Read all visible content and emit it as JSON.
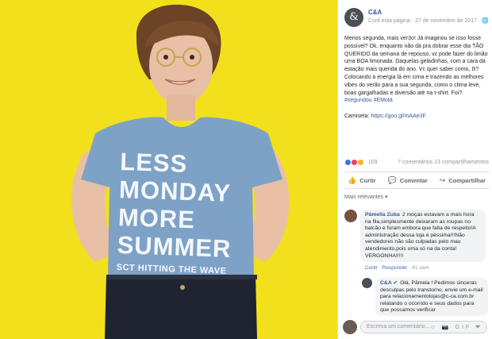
{
  "colors": {
    "photo_background": "#f2e01c",
    "link": "#385898",
    "shirt": "#7ea2c6"
  },
  "photo": {
    "shirt_lines": [
      "LESS",
      "MONDAY",
      "MORE",
      "SUMMER"
    ],
    "shirt_small_line": "SCT HITTING THE WAVE"
  },
  "post": {
    "page_name": "C&A",
    "avatar_glyph": "&",
    "meta": "Curti esta página · 27 de novembro de 2017 · 🌐",
    "body_main": "Menos segunda, mais ver3o! Já imaginou se isso fosse possível? Ok, enquanto não dá pra dobrar esse dia TÃO QUERIDO da semana de repouso, vc pode fazer do limão uma BOA limonada. Daquelas geladinhas, com a cara da estação mais querida do ano. Vc quer saber como, ẞ? Colocando a energia lá em cima e trazendo as melhores vibes do verão para a sua segunda, como o clima leve, boas gargalhadas e diversão até na t-shirt. Foi?",
    "hashtag": "#segundou #EMotá",
    "shirt_label": "Camiseta:",
    "shirt_link": "https://goo.gl/mAAe3F"
  },
  "reactions": {
    "icons": [
      "like",
      "love",
      "haha"
    ],
    "count": "169",
    "summary": "7 comentários  13 compartilhamentos"
  },
  "actions": [
    {
      "icon": "thumbs-up-icon",
      "glyph": "👍",
      "label": "Curtir"
    },
    {
      "icon": "comment-icon",
      "glyph": "💬",
      "label": "Comentar"
    },
    {
      "icon": "share-icon",
      "glyph": "↪",
      "label": "Compartilhar"
    }
  ],
  "relevance_label": "Mais relevantes ▾",
  "comments": [
    {
      "author": "Pâmella Zuba",
      "text": "2 moças estavam a mais hora na fila,simplesmente deixaram as roupas no balcão e foram embora que falta de respeito!A administração dessa loja é péssima!!!Não vendedores não são culpadas pelo mau atendimento,pois uma só na da conta! VERGONHA!!!!!",
      "footer_like": "Curtir",
      "footer_reply": "Responder",
      "footer_time": "· 41 sem"
    },
    {
      "author": "C&A ✔",
      "text": "Olá, Pâmela ! Pedimos sinceras desculpas pelo transtorno, envie um e-mail para relacionamentolojas@c-ca.com.br relatando o ocorrido e seus dados para que possamos verificar"
    }
  ],
  "composer": {
    "placeholder": "Escreva um comentário...",
    "icons": "☺ 📷 GIF ❤"
  }
}
